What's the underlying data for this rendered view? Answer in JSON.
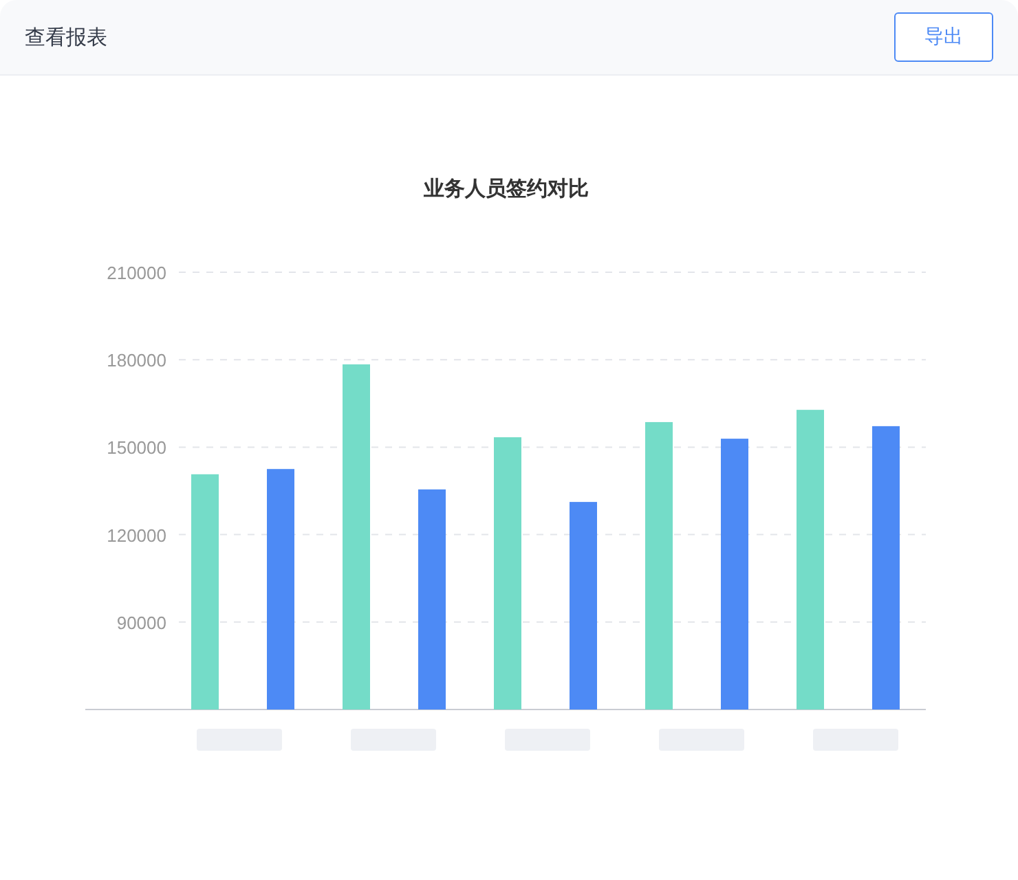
{
  "header": {
    "title": "查看报表",
    "export_button": "导出"
  },
  "chart": {
    "chart_data": {
      "type": "bar",
      "grid": true,
      "title": "业务人员签约对比",
      "ylim": [
        60000,
        210000
      ],
      "yticks": [
        90000,
        120000,
        150000,
        180000,
        210000
      ],
      "series": [
        {
          "color": "#74dcc8",
          "values": [
            140700,
            178400,
            153400,
            158600,
            162800
          ]
        },
        {
          "color": "#4d8af5",
          "values": [
            142500,
            135500,
            131200,
            152900,
            157200
          ]
        }
      ]
    }
  }
}
